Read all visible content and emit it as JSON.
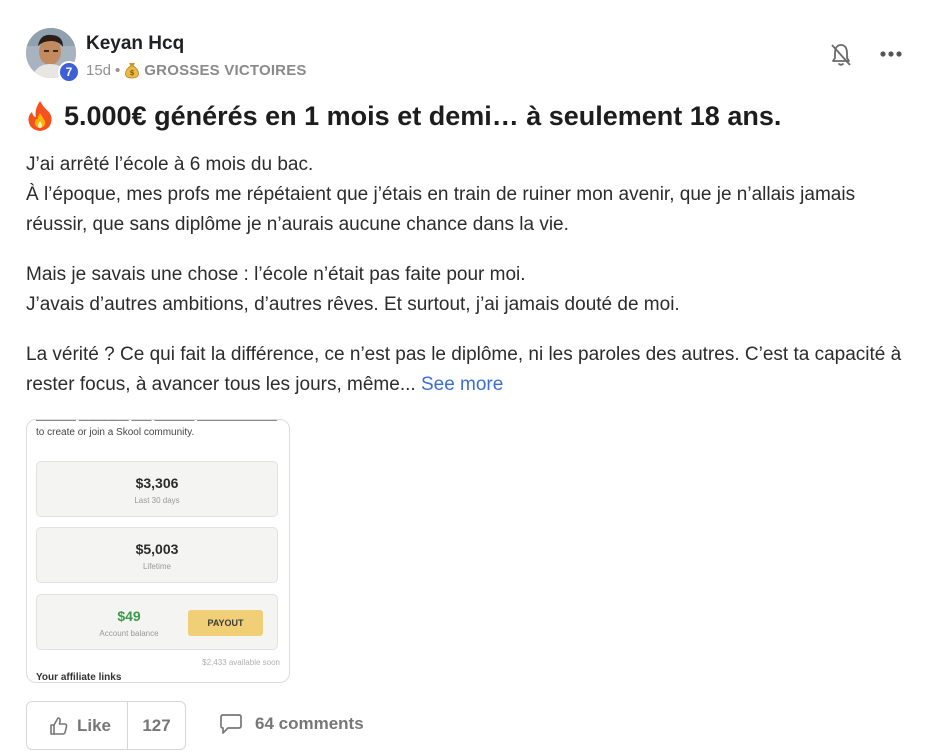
{
  "post": {
    "author": "Keyan Hcq",
    "level": "7",
    "time": "15d",
    "separator": "•",
    "category": "GROSSES VICTOIRES",
    "title": "5.000€ générés en 1 mois et demi… à seulement 18 ans.",
    "paragraphs": [
      "J’ai arrêté l’école à 6 mois du bac.\nÀ l’époque, mes profs me répétaient que j’étais en train de ruiner mon avenir, que je n’allais jamais réussir, que sans diplôme je n’aurais aucune chance dans la vie.",
      "Mais je savais une chose : l’école n’était pas faite pour moi.\nJ’avais d’autres ambitions, d’autres rêves. Et surtout, j’ai jamais douté de moi.",
      "La vérité ? Ce qui fait la différence, ce n’est pas le diplôme, ni les paroles des autres. C’est ta capacité à rester focus, à avancer tous les jours, même..."
    ],
    "see_more": "See more"
  },
  "screenshot": {
    "intro": "to create or join a Skool community.",
    "last30_value": "$3,306",
    "last30_label": "Last 30 days",
    "lifetime_value": "$5,003",
    "lifetime_label": "Lifetime",
    "balance_value": "$49",
    "balance_label": "Account balance",
    "payout_label": "PAYOUT",
    "available": "$2,433 available soon",
    "affiliate_links": "Your affiliate links"
  },
  "actions": {
    "like_label": "Like",
    "like_count": "127",
    "comments_label": "64 comments"
  },
  "icons": {
    "bell": "bell-off-icon",
    "more": "more-horizontal-icon",
    "like": "thumbs-up-icon",
    "comment": "comment-bubble-icon",
    "fire": "fire-emoji-icon",
    "money_bag": "money-bag-emoji-icon"
  },
  "colors": {
    "accent_link": "#3b6fd4",
    "level_badge": "#3f5fd6",
    "payout_button": "#f0cf77",
    "balance_green": "#3a9b4a"
  }
}
